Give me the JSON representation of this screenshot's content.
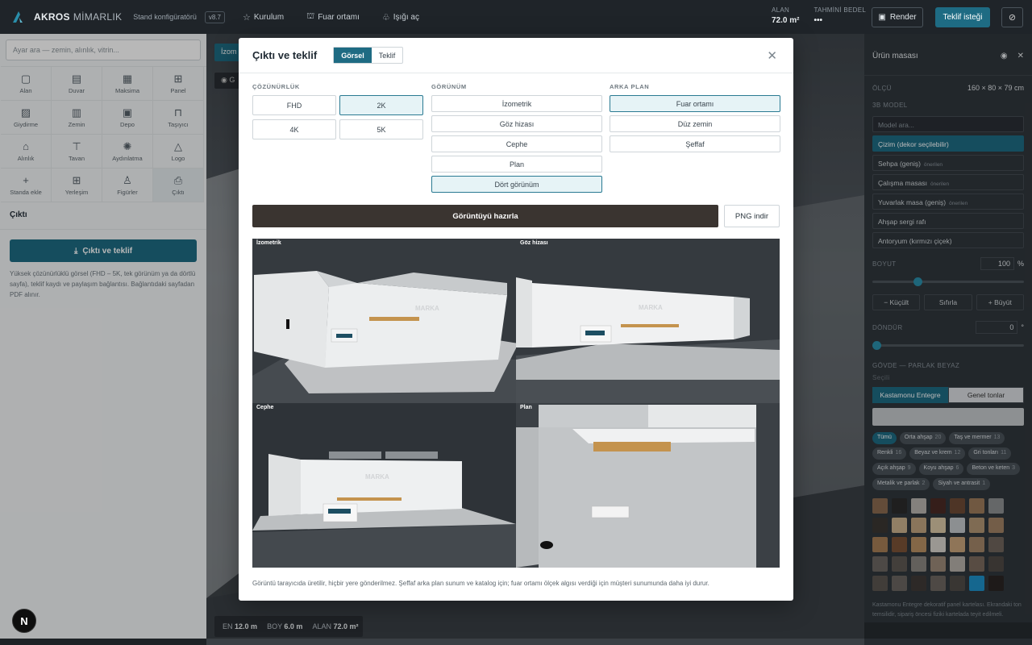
{
  "topbar": {
    "brand_bold": "AKROS",
    "brand_light": "MİMARLIK",
    "subtitle": "Stand konfigüratörü",
    "version": "v8.7",
    "nav": [
      {
        "icon": "star-icon",
        "label": "Kurulum"
      },
      {
        "icon": "fair-icon",
        "label": "Fuar ortamı"
      },
      {
        "icon": "light-icon",
        "label": "Işığı aç"
      }
    ],
    "area_label": "ALAN",
    "area_value": "72.0 m²",
    "cost_label": "TAHMİNİ BEDEL",
    "cost_value": "•••",
    "render_label": "Render",
    "quote_label": "Teklif isteği"
  },
  "left": {
    "search_placeholder": "Ayar ara — zemin, alınlık, vitrin...",
    "tools": [
      {
        "icon": "area-icon",
        "glyph": "▢",
        "label": "Alan"
      },
      {
        "icon": "wall-icon",
        "glyph": "▤",
        "label": "Duvar"
      },
      {
        "icon": "maksima-icon",
        "glyph": "▦",
        "label": "Maksima"
      },
      {
        "icon": "panel-icon",
        "glyph": "⊞",
        "label": "Panel"
      },
      {
        "icon": "cladding-icon",
        "glyph": "▨",
        "label": "Giydirme"
      },
      {
        "icon": "floor-icon",
        "glyph": "▥",
        "label": "Zemin"
      },
      {
        "icon": "storage-icon",
        "glyph": "▣",
        "label": "Depo"
      },
      {
        "icon": "truss-icon",
        "glyph": "⊓",
        "label": "Taşıyıcı"
      },
      {
        "icon": "fascia-icon",
        "glyph": "⌂",
        "label": "Alınlık"
      },
      {
        "icon": "ceiling-icon",
        "glyph": "⊤",
        "label": "Tavan"
      },
      {
        "icon": "lighting-icon",
        "glyph": "✺",
        "label": "Aydınlatma"
      },
      {
        "icon": "logo-icon",
        "glyph": "△",
        "label": "Logo"
      },
      {
        "icon": "add-icon",
        "glyph": "+",
        "label": "Standa ekle"
      },
      {
        "icon": "layout-icon",
        "glyph": "⊞",
        "label": "Yerleşim"
      },
      {
        "icon": "figure-icon",
        "glyph": "♙",
        "label": "Figürler"
      },
      {
        "icon": "printer-icon",
        "glyph": "⎙",
        "label": "Çıktı"
      }
    ],
    "section_title": "Çıktı",
    "action_label": "Çıktı ve teklif",
    "note": "Yüksek çözünürlüklü görsel (FHD – 5K, tek görünüm ya da dörtlü sayfa), teklif kaydı ve paylaşım bağlantısı. Bağlantıdaki sayfadan PDF alınır."
  },
  "scene": {
    "tab_label": "İzom",
    "view_label": "◉ G",
    "dims": [
      {
        "label": "EN",
        "value": "12.0 m"
      },
      {
        "label": "BOY",
        "value": "6.0 m"
      },
      {
        "label": "ALAN",
        "value": "72.0 m²"
      }
    ]
  },
  "right": {
    "title": "Ürün masası",
    "size_label": "ÖLÇÜ",
    "size_value": "160 × 80 × 79 cm",
    "model_label": "3B MODEL",
    "model_placeholder": "Model ara...",
    "models": [
      {
        "label": "Çizim (dekor seçilebilir)",
        "tag": "",
        "selected": true
      },
      {
        "label": "Sehpa (geniş)",
        "tag": "önerilen",
        "selected": false
      },
      {
        "label": "Çalışma masası",
        "tag": "önerilen",
        "selected": false
      },
      {
        "label": "Yuvarlak masa (geniş)",
        "tag": "önerilen",
        "selected": false
      },
      {
        "label": "Ahşap sergi rafı",
        "tag": "",
        "selected": false
      },
      {
        "label": "Antoryum (kırmızı çiçek)",
        "tag": "",
        "selected": false
      }
    ],
    "scale_label": "BOYUT",
    "scale_value": "100",
    "scale_unit": "%",
    "scale_level": 0.3,
    "scale_buttons": [
      "− Küçült",
      "Sıfırla",
      "+ Büyüt"
    ],
    "rotate_label": "DÖNDÜR",
    "rotate_value": "0",
    "rotate_unit": "°",
    "rotate_level": 0,
    "body_label": "GÖVDE — PARLAK BEYAZ",
    "body_sub": "Seçili",
    "brand_tabs": [
      "Kastamonu Entegre",
      "Genel tonlar"
    ],
    "chips": [
      {
        "label": "Tümü",
        "count": "",
        "on": true
      },
      {
        "label": "Orta ahşap",
        "count": "20",
        "on": false
      },
      {
        "label": "Taş ve mermer",
        "count": "13",
        "on": false
      },
      {
        "label": "Renkli",
        "count": "16",
        "on": false
      },
      {
        "label": "Beyaz ve krem",
        "count": "12",
        "on": false
      },
      {
        "label": "Gri tonları",
        "count": "11",
        "on": false
      },
      {
        "label": "Açık ahşap",
        "count": "9",
        "on": false
      },
      {
        "label": "Koyu ahşap",
        "count": "6",
        "on": false
      },
      {
        "label": "Beton ve keten",
        "count": "3",
        "on": false
      },
      {
        "label": "Metalik ve parlak",
        "count": "2",
        "on": false
      },
      {
        "label": "Siyah ve antrasit",
        "count": "1",
        "on": false
      }
    ],
    "swatches": [
      "#8a6a4f",
      "#2b2b2b",
      "#b8b3ad",
      "#4a2a25",
      "#6d4a35",
      "#9b7a5a",
      "#8c8f91",
      "#3b3632",
      "#c9b08c",
      "#bfa37e",
      "#d8c7a6",
      "#c3c7c9",
      "#b09574",
      "#a08265",
      "#a67d55",
      "#7a5236",
      "#b88f63",
      "#d6d2cb",
      "#c6a27a",
      "#a28568",
      "#6f645c",
      "#6b6661",
      "#5d5852",
      "#8a8580",
      "#9a8878",
      "#b4afa8",
      "#7b6a5d",
      "#4e4944",
      "#5a554f",
      "#6a6560",
      "#3f3a36",
      "#6c6660",
      "#4f4b47",
      "#1e8fc7",
      "#2a2523"
    ],
    "footnote": "Kastamonu Entegre dekoratif panel kartelası. Ekrandaki ton temsilidir, sipariş öncesi fiziki kartelada teyit edilmeli."
  },
  "modal": {
    "title": "Çıktı ve teklif",
    "tabs": [
      "Görsel",
      "Teklif"
    ],
    "resolution_label": "ÇÖZÜNÜRLÜK",
    "resolutions": [
      {
        "label": "FHD",
        "selected": false
      },
      {
        "label": "2K",
        "selected": true
      },
      {
        "label": "4K",
        "selected": false
      },
      {
        "label": "5K",
        "selected": false
      }
    ],
    "view_label": "GÖRÜNÜM",
    "views": [
      {
        "label": "İzometrik",
        "selected": false
      },
      {
        "label": "Göz hizası",
        "selected": false
      },
      {
        "label": "Cephe",
        "selected": false
      },
      {
        "label": "Plan",
        "selected": false
      },
      {
        "label": "Dört görünüm",
        "selected": true
      }
    ],
    "bg_label": "ARKA PLAN",
    "backgrounds": [
      {
        "label": "Fuar ortamı",
        "selected": true
      },
      {
        "label": "Düz zemin",
        "selected": false
      },
      {
        "label": "Şeffaf",
        "selected": false
      }
    ],
    "generate_label": "Görüntüyü hazırla",
    "png_label": "PNG indir",
    "previews": [
      "İzometrik",
      "Göz hizası",
      "Cephe",
      "Plan"
    ],
    "brand_on_wall": "MARKA",
    "footer": "Görüntü tarayıcıda üretilir, hiçbir yere gönderilmez. Şeffaf arka plan sunum ve katalog için; fuar ortamı ölçek algısı verdiği için müşteri sunumunda daha iyi durur."
  },
  "badge": "N"
}
